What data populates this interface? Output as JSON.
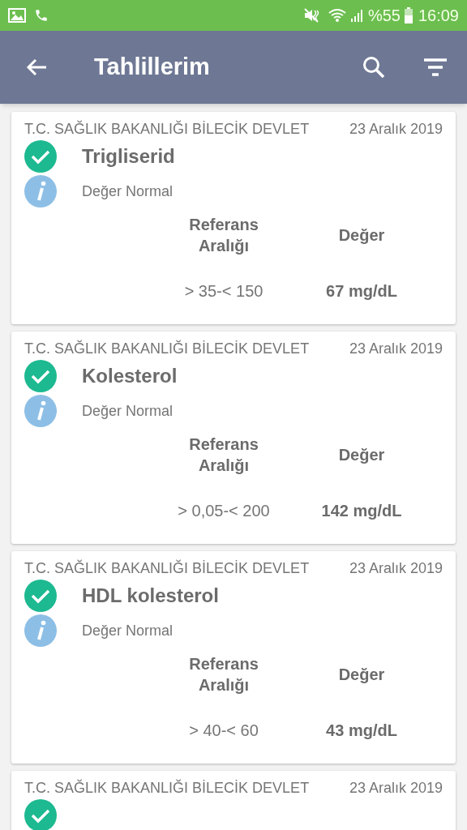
{
  "status_bar": {
    "battery": "%55",
    "time": "16:09"
  },
  "app_bar": {
    "title": "Tahlillerim"
  },
  "results": [
    {
      "institution": "T.C. SAĞLIK BAKANLIĞI BİLECİK DEVLET",
      "date": "23 Aralık 2019",
      "normal": true,
      "test": "Trigliserid",
      "note": "Değer Normal",
      "reference_header": "Referans Aralığı",
      "value_header": "Değer",
      "reference": "> 35-< 150",
      "value": "67 mg/dL"
    },
    {
      "institution": "T.C. SAĞLIK BAKANLIĞI BİLECİK DEVLET",
      "date": "23 Aralık 2019",
      "normal": true,
      "test": "Kolesterol",
      "note": "Değer Normal",
      "reference_header": "Referans Aralığı",
      "value_header": "Değer",
      "reference": "> 0,05-< 200",
      "value": "142 mg/dL"
    },
    {
      "institution": "T.C. SAĞLIK BAKANLIĞI BİLECİK DEVLET",
      "date": "23 Aralık 2019",
      "normal": true,
      "test": "HDL kolesterol",
      "note": "Değer Normal",
      "reference_header": "Referans Aralığı",
      "value_header": "Değer",
      "reference": "> 40-< 60",
      "value": "43 mg/dL"
    },
    {
      "institution": "T.C. SAĞLIK BAKANLIĞI BİLECİK DEVLET",
      "date": "23 Aralık 2019",
      "normal": true
    }
  ]
}
